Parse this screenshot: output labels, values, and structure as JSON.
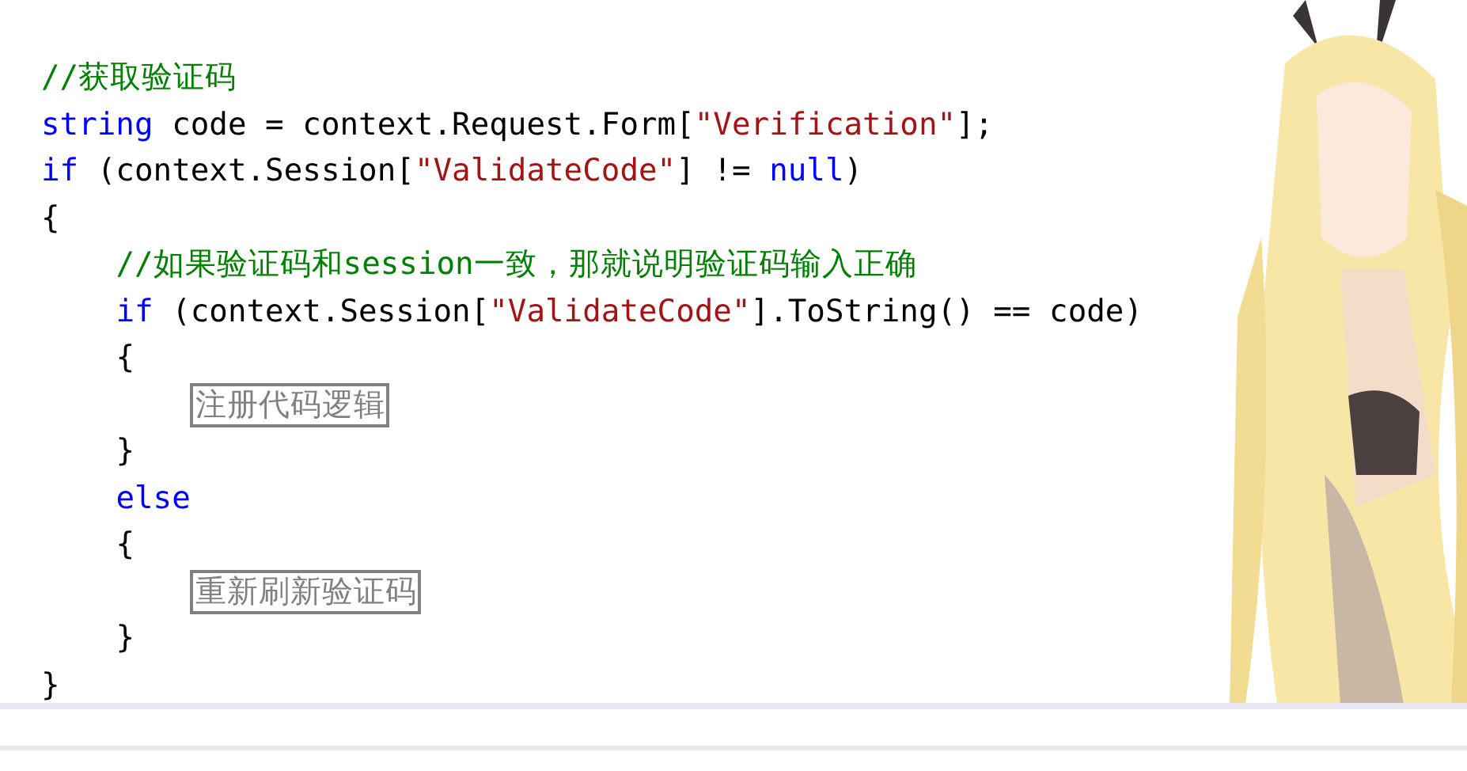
{
  "code_lines": [
    {
      "tokens": [
        {
          "kind": "comment",
          "text": "//获取验证码"
        }
      ]
    },
    {
      "tokens": [
        {
          "kind": "keyword",
          "text": "string"
        },
        {
          "kind": "plain",
          "text": " code = context.Request.Form["
        },
        {
          "kind": "string",
          "text": "\"Verification\""
        },
        {
          "kind": "plain",
          "text": "];"
        }
      ]
    },
    {
      "tokens": [
        {
          "kind": "keyword",
          "text": "if"
        },
        {
          "kind": "plain",
          "text": " (context.Session["
        },
        {
          "kind": "string",
          "text": "\"ValidateCode\""
        },
        {
          "kind": "plain",
          "text": "] != "
        },
        {
          "kind": "keyword",
          "text": "null"
        },
        {
          "kind": "plain",
          "text": ")"
        }
      ]
    },
    {
      "tokens": [
        {
          "kind": "plain",
          "text": "{"
        }
      ]
    },
    {
      "tokens": [
        {
          "kind": "comment",
          "text": "    //如果验证码和session一致，那就说明验证码输入正确"
        }
      ]
    },
    {
      "tokens": [
        {
          "kind": "keyword",
          "text": "    if"
        },
        {
          "kind": "plain",
          "text": " (context.Session["
        },
        {
          "kind": "string",
          "text": "\"ValidateCode\""
        },
        {
          "kind": "plain",
          "text": "].ToString() == code)"
        }
      ]
    },
    {
      "tokens": [
        {
          "kind": "plain",
          "text": "    {"
        }
      ]
    },
    {
      "tokens": [
        {
          "kind": "collapsed",
          "text": "        注册代码逻辑"
        }
      ]
    },
    {
      "tokens": [
        {
          "kind": "plain",
          "text": "    }"
        }
      ]
    },
    {
      "tokens": [
        {
          "kind": "keyword",
          "text": "    else"
        }
      ]
    },
    {
      "tokens": [
        {
          "kind": "plain",
          "text": "    {"
        }
      ]
    },
    {
      "tokens": [
        {
          "kind": "collapsed",
          "text": "        重新刷新验证码"
        }
      ]
    },
    {
      "tokens": [
        {
          "kind": "plain",
          "text": "    }"
        }
      ]
    },
    {
      "tokens": [
        {
          "kind": "plain",
          "text": "}"
        }
      ]
    }
  ]
}
